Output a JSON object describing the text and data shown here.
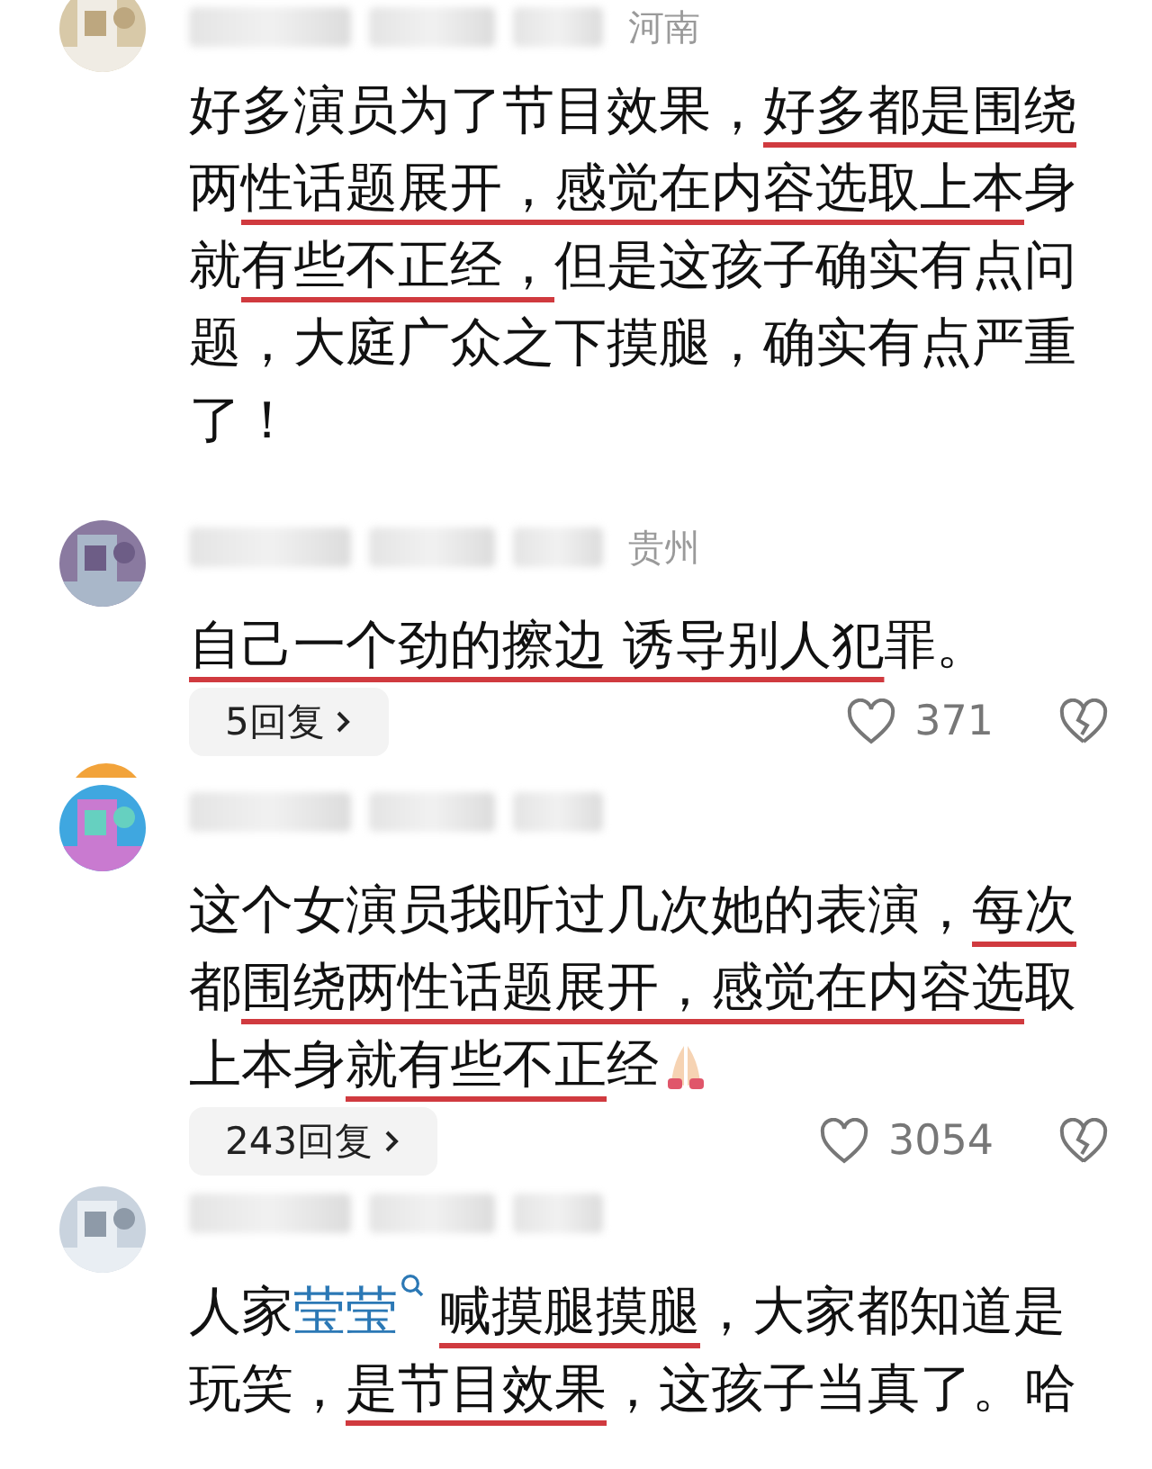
{
  "comments": [
    {
      "location": "河南",
      "lines": [
        [
          {
            "kind": "text",
            "text": "好多演员为了节目效果，",
            "underlined": false
          },
          {
            "kind": "text",
            "text": "好多都是围绕",
            "underlined": true
          }
        ],
        [
          {
            "kind": "text",
            "text": "两",
            "underlined": false
          },
          {
            "kind": "text",
            "text": "性话题展开，感觉在内容选取上本",
            "underlined": true
          },
          {
            "kind": "text",
            "text": "身",
            "underlined": false
          }
        ],
        [
          {
            "kind": "text",
            "text": "就",
            "underlined": false
          },
          {
            "kind": "text",
            "text": "有些不正经，",
            "underlined": true
          },
          {
            "kind": "text",
            "text": "但是这孩子确实有点问",
            "underlined": false
          }
        ],
        [
          {
            "kind": "text",
            "text": "题，大庭广众之下摸腿，确实有点严重",
            "underlined": false
          }
        ],
        [
          {
            "kind": "text",
            "text": "了！",
            "underlined": false
          }
        ]
      ]
    },
    {
      "location": "贵州",
      "lines": [
        [
          {
            "kind": "text",
            "text": "自己一个劲的擦边 诱导别人犯",
            "underlined": true
          },
          {
            "kind": "text",
            "text": "罪。",
            "underlined": false
          }
        ]
      ],
      "replies": "5回复",
      "likes": "371"
    },
    {
      "lines": [
        [
          {
            "kind": "text",
            "text": "这个女演员我听过几次她的表演，",
            "underlined": false
          },
          {
            "kind": "text",
            "text": "每次",
            "underlined": true
          }
        ],
        [
          {
            "kind": "text",
            "text": "都",
            "underlined": false
          },
          {
            "kind": "text",
            "text": "围绕两性话题展开，感觉在内容选",
            "underlined": true
          },
          {
            "kind": "text",
            "text": "取",
            "underlined": false
          }
        ],
        [
          {
            "kind": "text",
            "text": "上本身",
            "underlined": false
          },
          {
            "kind": "text",
            "text": "就有些不正",
            "underlined": true
          },
          {
            "kind": "text",
            "text": "经",
            "underlined": false
          },
          {
            "kind": "emoji"
          }
        ]
      ],
      "replies": "243回复",
      "likes": "3054"
    },
    {
      "lines": [
        [
          {
            "kind": "text",
            "text": "人家",
            "underlined": false
          },
          {
            "kind": "link",
            "text": "莹莹",
            "underlined": false
          },
          {
            "kind": "text",
            "text": "喊摸腿摸腿",
            "underlined": true
          },
          {
            "kind": "text",
            "text": "，大家都知道是",
            "underlined": false
          }
        ],
        [
          {
            "kind": "text",
            "text": "玩笑，",
            "underlined": false
          },
          {
            "kind": "text",
            "text": "是节目效果",
            "underlined": true
          },
          {
            "kind": "text",
            "text": "，这孩子当真了。哈",
            "underlined": false
          }
        ]
      ]
    }
  ]
}
